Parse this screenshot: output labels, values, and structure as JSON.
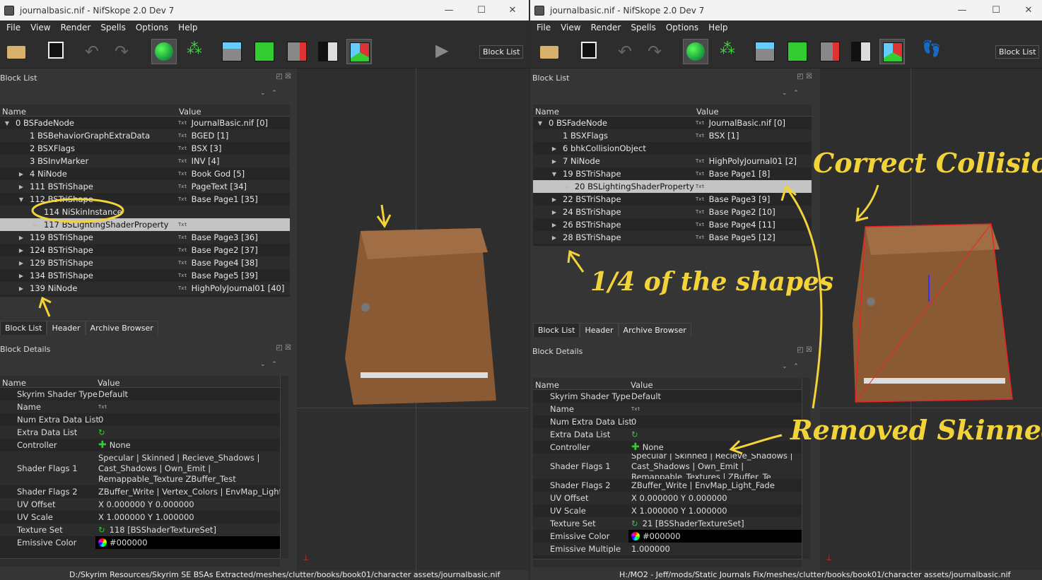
{
  "left": {
    "title": "journalbasic.nif - NifSkope 2.0 Dev 7",
    "menu": [
      "File",
      "View",
      "Render",
      "Spells",
      "Options",
      "Help"
    ],
    "block_list_button": "Block List",
    "block_list_title": "Block List",
    "col_name": "Name",
    "col_value": "Value",
    "tree": [
      {
        "name": "0 BSFadeNode",
        "value": "JournalBasic.nif [0]",
        "indent": 0,
        "arrow": "down"
      },
      {
        "name": "1 BSBehaviorGraphExtraData",
        "value": "BGED [1]",
        "indent": 1,
        "arrow": ""
      },
      {
        "name": "2 BSXFlags",
        "value": "BSX [3]",
        "indent": 1,
        "arrow": ""
      },
      {
        "name": "3 BSInvMarker",
        "value": "INV [4]",
        "indent": 1,
        "arrow": ""
      },
      {
        "name": "4 NiNode",
        "value": "Book God [5]",
        "indent": 1,
        "arrow": "right"
      },
      {
        "name": "111 BSTriShape",
        "value": "PageText [34]",
        "indent": 1,
        "arrow": "right"
      },
      {
        "name": "112 BSTriShape",
        "value": "Base Page1 [35]",
        "indent": 1,
        "arrow": "down"
      },
      {
        "name": "114 NiSkinInstance",
        "value": "",
        "indent": 2,
        "arrow": ""
      },
      {
        "name": "117 BSLightingShaderProperty",
        "value": "",
        "indent": 2,
        "arrow": "right",
        "hl": true
      },
      {
        "name": "119 BSTriShape",
        "value": "Base Page3 [36]",
        "indent": 1,
        "arrow": "right"
      },
      {
        "name": "124 BSTriShape",
        "value": "Base Page2 [37]",
        "indent": 1,
        "arrow": "right"
      },
      {
        "name": "129 BSTriShape",
        "value": "Base Page4 [38]",
        "indent": 1,
        "arrow": "right"
      },
      {
        "name": "134 BSTriShape",
        "value": "Base Page5 [39]",
        "indent": 1,
        "arrow": "right"
      },
      {
        "name": "139 NiNode",
        "value": "HighPolyJournal01 [40]",
        "indent": 1,
        "arrow": "right"
      }
    ],
    "tabs": [
      "Block List",
      "Header",
      "Archive Browser"
    ],
    "details_title": "Block Details",
    "details": [
      {
        "name": "Skyrim Shader Type",
        "value": "Default"
      },
      {
        "name": "Name",
        "value": "Txt",
        "kind": "txt"
      },
      {
        "name": "Num Extra Data List",
        "value": "0"
      },
      {
        "name": "Extra Data List",
        "value": "",
        "kind": "link"
      },
      {
        "name": "Controller",
        "value": "None",
        "kind": "plus"
      },
      {
        "name": "Shader Flags 1",
        "value": "Specular | Skinned | Recieve_Shadows | Cast_Shadows | Own_Emit | Remappable_Texture ZBuffer_Test",
        "kind": "tall"
      },
      {
        "name": "Shader Flags 2",
        "value": "ZBuffer_Write | Vertex_Colors | EnvMap_Light_Fac"
      },
      {
        "name": "UV Offset",
        "value": "X 0.000000 Y 0.000000"
      },
      {
        "name": "UV Scale",
        "value": "X 1.000000 Y 1.000000"
      },
      {
        "name": "Texture Set",
        "value": "118 [BSShaderTextureSet]",
        "kind": "link"
      },
      {
        "name": "Emissive Color",
        "value": "#000000",
        "kind": "color"
      }
    ],
    "status": "D:/Skyrim Resources/Skyrim SE BSAs Extracted/meshes/clutter/books/book01/character assets/journalbasic.nif"
  },
  "right": {
    "title": "journalbasic.nif - NifSkope 2.0 Dev 7",
    "menu": [
      "File",
      "View",
      "Render",
      "Spells",
      "Options",
      "Help"
    ],
    "block_list_button": "Block List",
    "block_list_title": "Block List",
    "col_name": "Name",
    "col_value": "Value",
    "tree": [
      {
        "name": "0 BSFadeNode",
        "value": "JournalBasic.nif [0]",
        "indent": 0,
        "arrow": "down"
      },
      {
        "name": "1 BSXFlags",
        "value": "BSX [1]",
        "indent": 1,
        "arrow": ""
      },
      {
        "name": "6 bhkCollisionObject",
        "value": "",
        "indent": 1,
        "arrow": "right"
      },
      {
        "name": "7 NiNode",
        "value": "HighPolyJournal01 [2]",
        "indent": 1,
        "arrow": "right"
      },
      {
        "name": "19 BSTriShape",
        "value": "Base Page1 [8]",
        "indent": 1,
        "arrow": "down"
      },
      {
        "name": "20 BSLightingShaderProperty",
        "value": "",
        "indent": 2,
        "arrow": "right",
        "hl": true
      },
      {
        "name": "22 BSTriShape",
        "value": "Base Page3 [9]",
        "indent": 1,
        "arrow": "right"
      },
      {
        "name": "24 BSTriShape",
        "value": "Base Page2 [10]",
        "indent": 1,
        "arrow": "right"
      },
      {
        "name": "26 BSTriShape",
        "value": "Base Page4 [11]",
        "indent": 1,
        "arrow": "right"
      },
      {
        "name": "28 BSTriShape",
        "value": "Base Page5 [12]",
        "indent": 1,
        "arrow": "right"
      }
    ],
    "tabs": [
      "Block List",
      "Header",
      "Archive Browser"
    ],
    "details_title": "Block Details",
    "details": [
      {
        "name": "Skyrim Shader Type",
        "value": "Default"
      },
      {
        "name": "Name",
        "value": "Txt",
        "kind": "txt"
      },
      {
        "name": "Num Extra Data List",
        "value": "0"
      },
      {
        "name": "Extra Data List",
        "value": "",
        "kind": "link"
      },
      {
        "name": "Controller",
        "value": "None",
        "kind": "plus"
      },
      {
        "name": "Shader Flags 1",
        "value": "Specular | Skinned | Recieve_Shadows | Cast_Shadows | Own_Emit | Remappable_Textures | ZBuffer_Te",
        "kind": "mid"
      },
      {
        "name": "Shader Flags 2",
        "value": "ZBuffer_Write | EnvMap_Light_Fade"
      },
      {
        "name": "UV Offset",
        "value": "X 0.000000 Y 0.000000"
      },
      {
        "name": "UV Scale",
        "value": "X 1.000000 Y 1.000000"
      },
      {
        "name": "Texture Set",
        "value": "21 [BSShaderTextureSet]",
        "kind": "link"
      },
      {
        "name": "Emissive Color",
        "value": "#000000",
        "kind": "color"
      },
      {
        "name": "Emissive Multiple",
        "value": "1.000000"
      }
    ],
    "status": "H:/MO2 - Jeff/mods/Static Journals Fix/meshes/clutter/books/book01/character assets/journalbasic.nif"
  },
  "annotations": {
    "correct_collision": "Correct Collision",
    "quarter_shapes": "1/4 of the shapes",
    "removed_skinned": "Removed Skinned"
  },
  "window_controls": [
    "—",
    "☐",
    "✕"
  ],
  "accent_yellow": "#f3d33a"
}
